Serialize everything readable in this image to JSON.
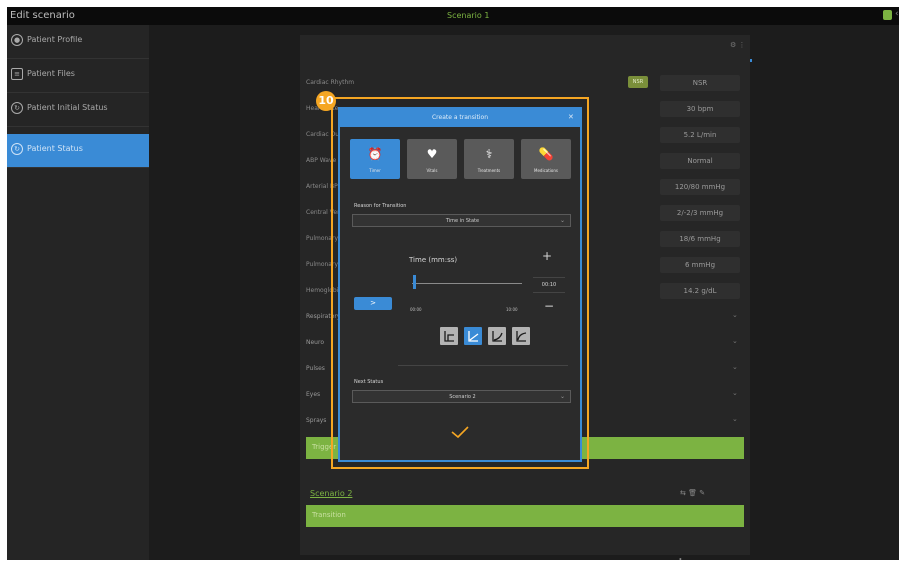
{
  "window": {
    "title": "Edit scenario",
    "scenario_name": "Scenario 1"
  },
  "sidebar": {
    "items": [
      {
        "label": "Patient Profile",
        "icon": "user-icon"
      },
      {
        "label": "Patient Files",
        "icon": "file-icon"
      },
      {
        "label": "Patient Initial Status",
        "icon": "status-icon"
      },
      {
        "label": "Patient Status",
        "icon": "status-icon",
        "active": true
      }
    ]
  },
  "vitals": {
    "rows": [
      {
        "name": "Cardiac Rhythm",
        "value": "NSR"
      },
      {
        "name": "Heart Rate",
        "value": "30 bpm"
      },
      {
        "name": "Cardiac Output",
        "value": "5.2 L/min"
      },
      {
        "name": "ABP Wave",
        "value": "Normal"
      },
      {
        "name": "Arterial BP",
        "value": "120/80 mmHg"
      },
      {
        "name": "Central Venous",
        "value": "2/-2/3 mmHg"
      },
      {
        "name": "Pulmonary Artery",
        "value": "18/6 mmHg"
      },
      {
        "name": "Pulmonary Wedge",
        "value": "6 mmHg"
      },
      {
        "name": "Hemoglobin",
        "value": "14.2 g/dL"
      }
    ],
    "nsr_button": "NSR",
    "sections": [
      "Respiratory",
      "Neuro",
      "Pulses",
      "Eyes",
      "Sprays"
    ]
  },
  "green_bar_label": "Trigger",
  "scenario2": {
    "title": "Scenario 2",
    "transition_label": "Transition"
  },
  "annotation": {
    "number": "10"
  },
  "dialog": {
    "title": "Create a transition",
    "tabs": [
      {
        "label": "Timer",
        "icon": "timer-icon"
      },
      {
        "label": "Vitals",
        "icon": "heart-icon"
      },
      {
        "label": "Treatments",
        "icon": "treatment-icon"
      },
      {
        "label": "Medications",
        "icon": "medication-icon"
      }
    ],
    "reason_label": "Reason for Transition",
    "reason_value": "Time in State",
    "time_label": "Time (mm:ss)",
    "slider_min": "00:00",
    "slider_max": "10:00",
    "time_value": "00:10",
    "slider_fraction": 0.017,
    "next_button": ">",
    "next_status_label": "Next Status",
    "next_status_value": "Scenario 2"
  }
}
